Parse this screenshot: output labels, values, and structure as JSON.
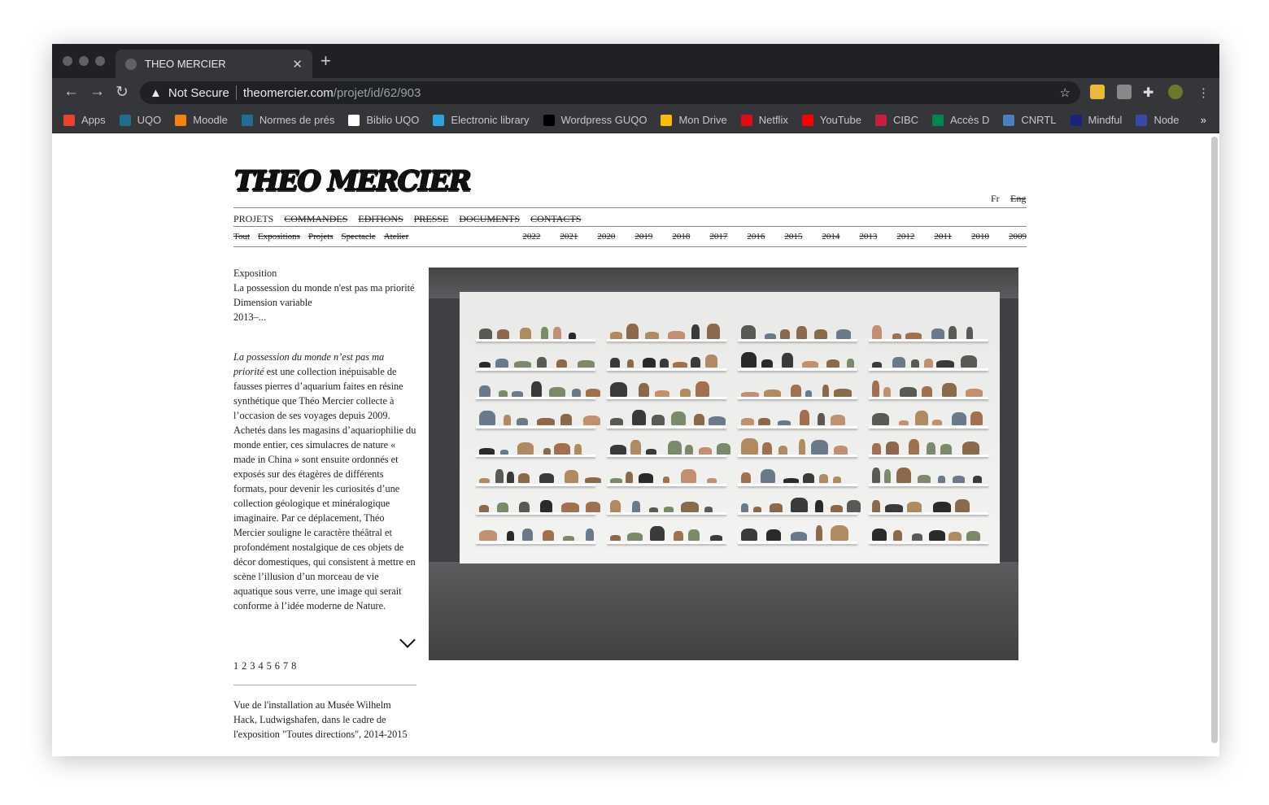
{
  "browser": {
    "tab_title": "THEO MERCIER",
    "security": "Not Secure",
    "url_domain": "theomercier.com",
    "url_path": "/projet/id/62/903",
    "bookmarks": [
      {
        "label": "Apps",
        "color": "#e94235"
      },
      {
        "label": "UQO",
        "color": "#1f6d8f"
      },
      {
        "label": "Moodle",
        "color": "#f98012"
      },
      {
        "label": "Normes de prés",
        "color": "#1f6d8f"
      },
      {
        "label": "Biblio UQO",
        "color": "#ffffff"
      },
      {
        "label": "Electronic library",
        "color": "#2aa3e0"
      },
      {
        "label": "Wordpress GUQO",
        "color": "#000000"
      },
      {
        "label": "Mon Drive",
        "color": "#fbbc04"
      },
      {
        "label": "Netflix",
        "color": "#e50914"
      },
      {
        "label": "YouTube",
        "color": "#ff0000"
      },
      {
        "label": "CIBC",
        "color": "#c41f3e"
      },
      {
        "label": "Accès D",
        "color": "#00874e"
      },
      {
        "label": "CNRTL",
        "color": "#4a7fc1"
      },
      {
        "label": "Mindful",
        "color": "#1a237e"
      },
      {
        "label": "Node",
        "color": "#3949ab"
      }
    ]
  },
  "site": {
    "logo": "THEO MERCIER",
    "lang": {
      "fr": "Fr",
      "en": "Eng"
    },
    "menu": [
      "PROJETS",
      "COMMANDES",
      "EDITIONS",
      "PRESSE",
      "DOCUMENTS",
      "CONTACTS"
    ],
    "categories": [
      "Tout",
      "Expositions",
      "Projets",
      "Spectacle",
      "Atelier"
    ],
    "years": [
      "2022",
      "2021",
      "2020",
      "2019",
      "2018",
      "2017",
      "2016",
      "2015",
      "2014",
      "2013",
      "2012",
      "2011",
      "2010",
      "2009"
    ]
  },
  "project": {
    "type": "Exposition",
    "title": "La possession du monde n'est pas ma priorité",
    "dimension": "Dimension variable",
    "date": "2013–...",
    "desc_title": "La possession du monde n’est pas ma priorité",
    "desc_body": " est une collection inépuisable de fausses pierres d’aquarium faites en résine synthétique que Théo Mercier collecte à l’occasion de ses voyages depuis 2009. Achetés dans les magasins d’aquariophilie du monde entier, ces simulacres de nature « made in China » sont ensuite ordonnés et exposés sur des étagères de différents formats, pour devenir les curiosités d’une collection géologique et minéralogique imaginaire. Par ce déplacement, Théo Mercier souligne le caractère théâtral et profondément nostalgique de ces objets de décor domestiques, qui consistent à mettre en scène l’illusion d’un morceau de vie aquatique sous verre, une image qui serait conforme à l’idée moderne de Nature.",
    "pages": [
      "1",
      "2",
      "3",
      "4",
      "5",
      "6",
      "7",
      "8"
    ],
    "caption": "Vue de l'installation au Musée Wilhelm Hack, Ludwigshafen, dans le cadre de l'exposition \"Toutes directions\", 2014-2015"
  }
}
